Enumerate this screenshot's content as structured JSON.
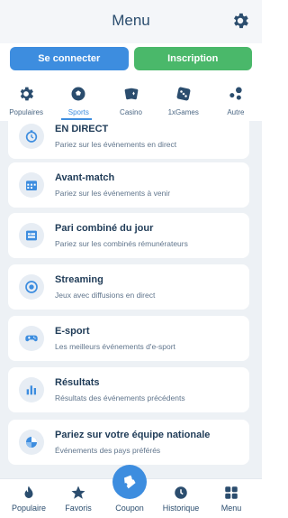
{
  "header": {
    "title": "Menu",
    "settings_icon": "gear-icon"
  },
  "auth": {
    "login_label": "Se connecter",
    "signup_label": "Inscription"
  },
  "categories": [
    {
      "label": "Populaires",
      "icon": "gear-icon",
      "active": false
    },
    {
      "label": "Sports",
      "icon": "soccer-ball-icon",
      "active": true
    },
    {
      "label": "Casino",
      "icon": "playing-cards-icon",
      "active": false
    },
    {
      "label": "1xGames",
      "icon": "dice-icon",
      "active": false
    },
    {
      "label": "Autre",
      "icon": "dots-icon",
      "active": false
    }
  ],
  "menu_items": [
    {
      "title": "EN DIRECT",
      "subtitle": "Pariez sur les événements en direct",
      "icon": "stopwatch-icon"
    },
    {
      "title": "Avant-match",
      "subtitle": "Pariez sur les événements à venir",
      "icon": "calendar-icon"
    },
    {
      "title": "Pari combiné du jour",
      "subtitle": "Pariez sur les combinés rémunérateurs",
      "icon": "ticket-list-icon"
    },
    {
      "title": "Streaming",
      "subtitle": "Jeux avec diffusions en direct",
      "icon": "stream-icon"
    },
    {
      "title": "E-sport",
      "subtitle": "Les meilleurs événements d'e-sport",
      "icon": "gamepad-icon"
    },
    {
      "title": "Résultats",
      "subtitle": "Résultats des événements précédents",
      "icon": "bar-chart-icon"
    },
    {
      "title": "Pariez sur votre équipe nationale",
      "subtitle": "Événements des pays préférés",
      "icon": "globe-icon"
    }
  ],
  "bottom_nav": [
    {
      "label": "Populaire",
      "icon": "flame-icon"
    },
    {
      "label": "Favoris",
      "icon": "star-icon"
    },
    {
      "label": "Coupon",
      "icon": "coupon-ticket-icon"
    },
    {
      "label": "Historique",
      "icon": "clock-icon"
    },
    {
      "label": "Menu",
      "icon": "grid-icon"
    }
  ],
  "colors": {
    "accent": "#3d8ddf",
    "signup": "#4ab86a",
    "text": "#1f3b57",
    "background": "#edf1f5"
  }
}
